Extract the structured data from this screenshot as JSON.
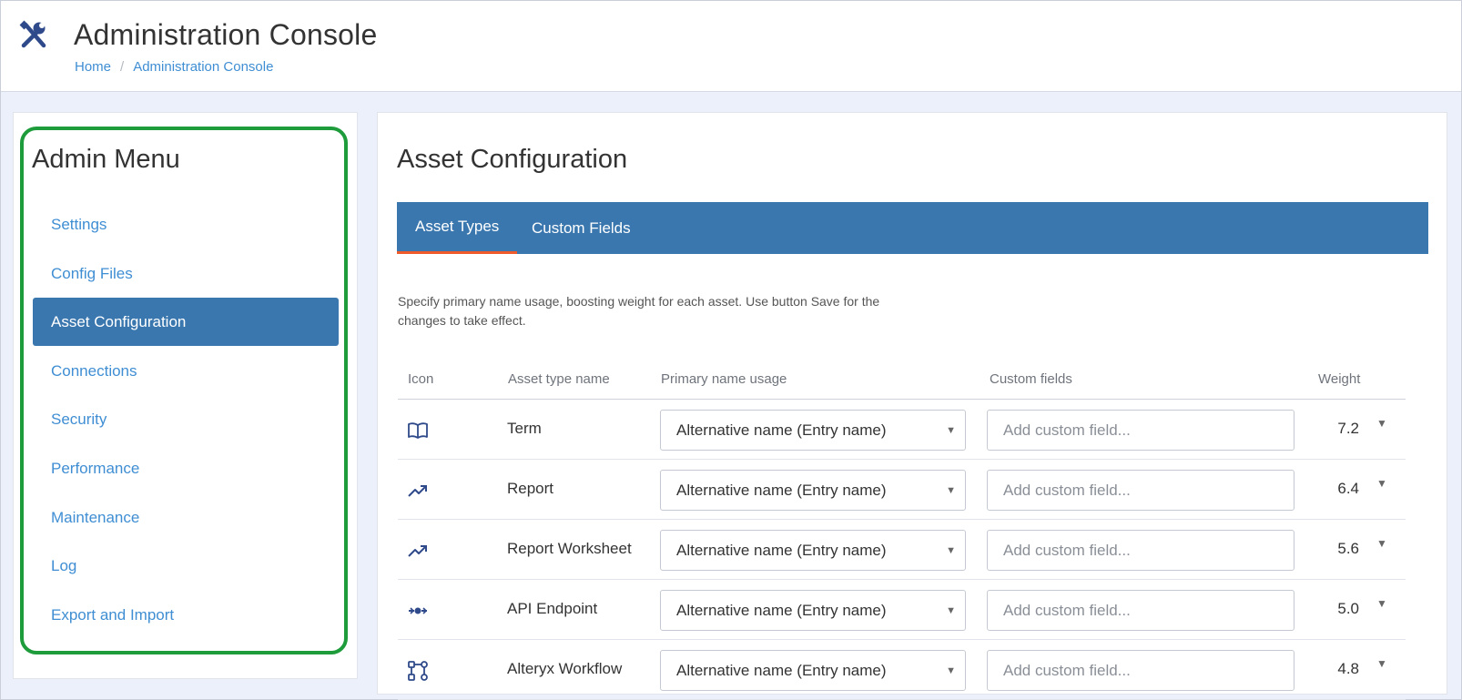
{
  "header": {
    "title": "Administration Console",
    "icon": "tools-icon",
    "breadcrumb": [
      "Home",
      "Administration Console"
    ]
  },
  "sidebar": {
    "title": "Admin Menu",
    "items": [
      {
        "label": "Settings",
        "active": false
      },
      {
        "label": "Config Files",
        "active": false
      },
      {
        "label": "Asset Configuration",
        "active": true
      },
      {
        "label": "Connections",
        "active": false
      },
      {
        "label": "Security",
        "active": false
      },
      {
        "label": "Performance",
        "active": false
      },
      {
        "label": "Maintenance",
        "active": false
      },
      {
        "label": "Log",
        "active": false
      },
      {
        "label": "Export and Import",
        "active": false
      }
    ]
  },
  "main": {
    "title": "Asset Configuration",
    "tabs": [
      {
        "label": "Asset Types",
        "active": true
      },
      {
        "label": "Custom Fields",
        "active": false
      }
    ],
    "description": "Specify primary name usage, boosting weight for each asset. Use button Save for the changes to take effect.",
    "table": {
      "columns": [
        "Icon",
        "Asset type name",
        "Primary name usage",
        "Custom fields",
        "Weight"
      ],
      "custom_field_placeholder": "Add custom field...",
      "rows": [
        {
          "icon": "book-icon",
          "name": "Term",
          "primary_name_usage": "Alternative name (Entry name)",
          "weight": "7.2"
        },
        {
          "icon": "trending-up-icon",
          "name": "Report",
          "primary_name_usage": "Alternative name (Entry name)",
          "weight": "6.4"
        },
        {
          "icon": "trending-up-icon",
          "name": "Report Worksheet",
          "primary_name_usage": "Alternative name (Entry name)",
          "weight": "5.6"
        },
        {
          "icon": "api-endpoint-icon",
          "name": "API Endpoint",
          "primary_name_usage": "Alternative name (Entry name)",
          "weight": "5.0"
        },
        {
          "icon": "workflow-icon",
          "name": "Alteryx Workflow",
          "primary_name_usage": "Alternative name (Entry name)",
          "weight": "4.8"
        }
      ]
    }
  },
  "colors": {
    "accent_blue": "#3a77ae",
    "link_blue": "#3f8ed3",
    "tab_underline": "#ef5a2a",
    "highlight_green": "#1e9c3c",
    "icon_navy": "#2f4a8a"
  }
}
